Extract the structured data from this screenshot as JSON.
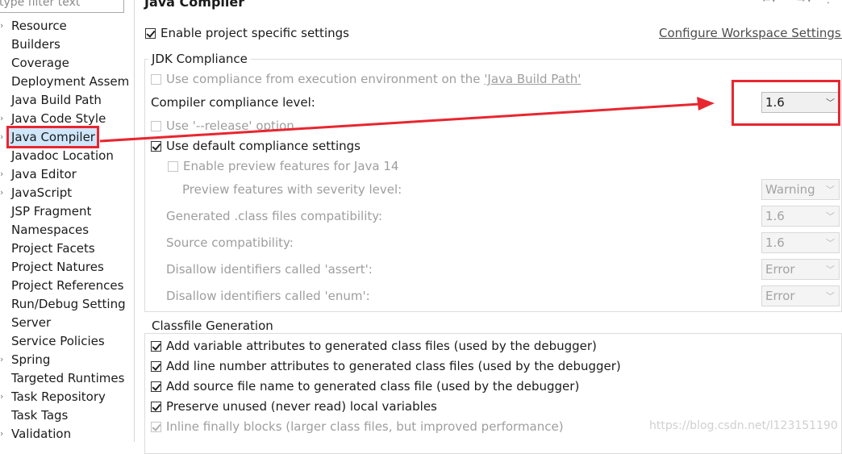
{
  "filter": {
    "placeholder": "type filter text"
  },
  "nav": {
    "items": [
      {
        "label": "Resource",
        "arrow": true
      },
      {
        "label": "Builders",
        "arrow": false
      },
      {
        "label": "Coverage",
        "arrow": false
      },
      {
        "label": "Deployment Assem",
        "arrow": false
      },
      {
        "label": "Java Build Path",
        "arrow": false
      },
      {
        "label": "Java Code Style",
        "arrow": true
      },
      {
        "label": "Java Compiler",
        "arrow": true,
        "selected": true
      },
      {
        "label": "Javadoc Location",
        "arrow": false
      },
      {
        "label": "Java Editor",
        "arrow": true
      },
      {
        "label": "JavaScript",
        "arrow": true
      },
      {
        "label": "JSP Fragment",
        "arrow": false
      },
      {
        "label": "Namespaces",
        "arrow": false
      },
      {
        "label": "Project Facets",
        "arrow": false
      },
      {
        "label": "Project Natures",
        "arrow": false
      },
      {
        "label": "Project References",
        "arrow": false
      },
      {
        "label": "Run/Debug Setting",
        "arrow": false
      },
      {
        "label": "Server",
        "arrow": false
      },
      {
        "label": "Service Policies",
        "arrow": false
      },
      {
        "label": "Spring",
        "arrow": true
      },
      {
        "label": "Targeted Runtimes",
        "arrow": false
      },
      {
        "label": "Task Repository",
        "arrow": true
      },
      {
        "label": "Task Tags",
        "arrow": false
      },
      {
        "label": "Validation",
        "arrow": true
      }
    ]
  },
  "header": {
    "title": "Java Compiler"
  },
  "main": {
    "enable_specific": "Enable project specific settings",
    "configure_link": "Configure Workspace Settings...",
    "jdk": {
      "title": "JDK Compliance",
      "use_env_prefix": "Use compliance from execution environment on the ",
      "use_env_link": "'Java Build Path'",
      "compliance_label": "Compiler compliance level:",
      "compliance_value": "1.6",
      "use_release": "Use '--release' option",
      "use_default": "Use default compliance settings",
      "enable_preview": "Enable preview features for Java 14",
      "preview_severity_label": "Preview features with severity level:",
      "preview_severity_value": "Warning",
      "generated_label": "Generated .class files compatibility:",
      "generated_value": "1.6",
      "source_label": "Source compatibility:",
      "source_value": "1.6",
      "assert_label": "Disallow identifiers called 'assert':",
      "assert_value": "Error",
      "enum_label": "Disallow identifiers called 'enum':",
      "enum_value": "Error"
    },
    "classfile": {
      "title": "Classfile Generation",
      "variable": "Add variable attributes to generated class files (used by the debugger)",
      "line_number": "Add line number attributes to generated class files (used by the debugger)",
      "source_file": "Add source file name to generated class file (used by the debugger)",
      "preserve": "Preserve unused (never read) local variables",
      "inline": "Inline finally blocks (larger class files, but improved performance)"
    }
  },
  "watermark": "https://blog.csdn.net/l123151190",
  "colors": {
    "annotation": "#e8262f",
    "selection": "#cfe6fb"
  }
}
